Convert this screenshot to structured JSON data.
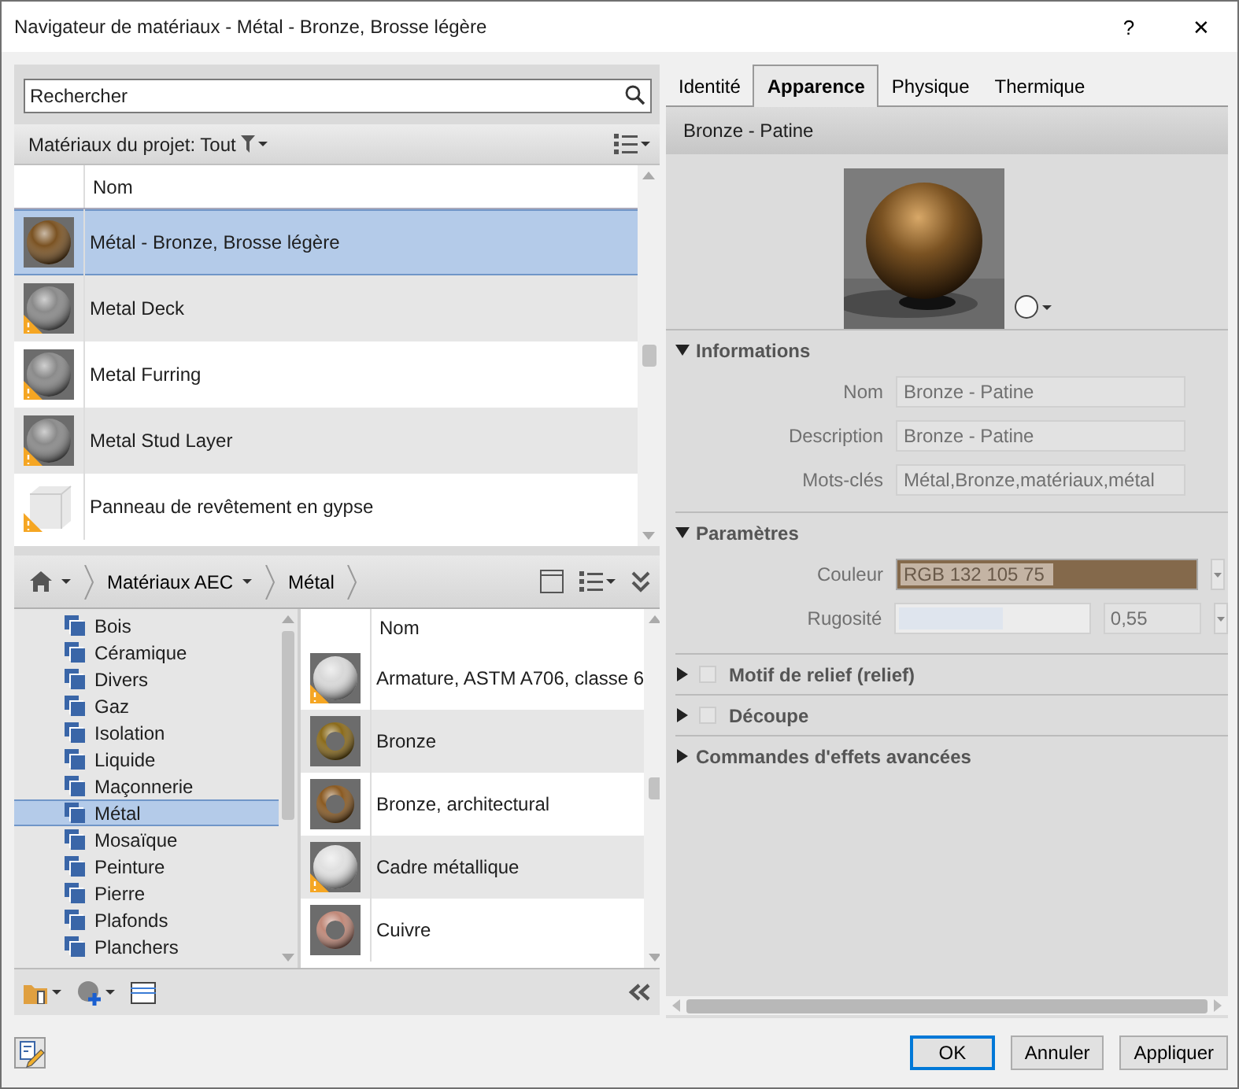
{
  "window": {
    "title": "Navigateur de matériaux - Métal - Bronze, Brosse légère",
    "help": "?",
    "close": "✕"
  },
  "search": {
    "placeholder": "Rechercher"
  },
  "project_filter": {
    "label": "Matériaux du projet: Tout"
  },
  "project_table": {
    "columns": [
      "Nom"
    ],
    "rows": [
      {
        "name": "Métal - Bronze, Brosse légère",
        "kind": "sphere",
        "color": "#7a5222",
        "warning": false,
        "selected": true
      },
      {
        "name": "Metal Deck",
        "kind": "sphere",
        "color": "#8a8a8a",
        "warning": true,
        "selected": false
      },
      {
        "name": "Metal Furring",
        "kind": "sphere",
        "color": "#8a8a8a",
        "warning": true,
        "selected": false
      },
      {
        "name": "Metal Stud Layer",
        "kind": "sphere",
        "color": "#8a8a8a",
        "warning": true,
        "selected": false
      },
      {
        "name": "Panneau de revêtement en gypse",
        "kind": "cube",
        "color": "#e8e8e8",
        "warning": true,
        "selected": false
      }
    ]
  },
  "breadcrumb": [
    {
      "label": "Matériaux AEC",
      "dropdown": true
    },
    {
      "label": "Métal",
      "dropdown": false
    }
  ],
  "library_tree": {
    "items": [
      {
        "label": "Bois",
        "selected": false
      },
      {
        "label": "Céramique",
        "selected": false
      },
      {
        "label": "Divers",
        "selected": false
      },
      {
        "label": "Gaz",
        "selected": false
      },
      {
        "label": "Isolation",
        "selected": false
      },
      {
        "label": "Liquide",
        "selected": false
      },
      {
        "label": "Maçonnerie",
        "selected": false
      },
      {
        "label": "Métal",
        "selected": true
      },
      {
        "label": "Mosaïque",
        "selected": false
      },
      {
        "label": "Peinture",
        "selected": false
      },
      {
        "label": "Pierre",
        "selected": false
      },
      {
        "label": "Plafonds",
        "selected": false
      },
      {
        "label": "Planchers",
        "selected": false
      }
    ]
  },
  "library_table": {
    "columns": [
      "Nom"
    ],
    "rows": [
      {
        "name": "Armature, ASTM A706, classe 6",
        "kind": "sphere",
        "color": "#d8d8d8",
        "warning": true,
        "selected": false
      },
      {
        "name": "Bronze",
        "kind": "torus",
        "color": "#8a6a1a",
        "warning": false,
        "selected": false
      },
      {
        "name": "Bronze, architectural",
        "kind": "torus",
        "color": "#8a5a22",
        "warning": false,
        "selected": false
      },
      {
        "name": "Cadre métallique",
        "kind": "sphere",
        "color": "#e0e0e0",
        "warning": true,
        "selected": false
      },
      {
        "name": "Cuivre",
        "kind": "torus",
        "color": "#c08878",
        "warning": false,
        "selected": false
      }
    ]
  },
  "tabs": [
    {
      "label": "Identité",
      "selected": false
    },
    {
      "label": "Apparence",
      "selected": true
    },
    {
      "label": "Physique",
      "selected": false
    },
    {
      "label": "Thermique",
      "selected": false
    }
  ],
  "asset": {
    "name": "Bronze - Patine"
  },
  "sections": [
    {
      "kind": "fields",
      "title": "Informations",
      "expanded": true,
      "fields": [
        {
          "label": "Nom",
          "value": "Bronze - Patine"
        },
        {
          "label": "Description",
          "value": "Bronze - Patine"
        },
        {
          "label": "Mots-clés",
          "value": "Métal,Bronze,matériaux,métal"
        }
      ]
    },
    {
      "kind": "params",
      "title": "Paramètres",
      "expanded": true,
      "params": [
        {
          "kind": "color",
          "label": "Couleur",
          "value": "RGB 132 105 75",
          "color": "#84694b"
        },
        {
          "kind": "slider",
          "label": "Rugosité",
          "level": 0.55,
          "value": "0,55"
        }
      ]
    },
    {
      "kind": "toggle",
      "title": "Motif de relief (relief)",
      "expanded": false,
      "checked": false
    },
    {
      "kind": "toggle",
      "title": "Découpe",
      "expanded": false,
      "checked": false
    },
    {
      "kind": "plain",
      "title": "Commandes d'effets avancées",
      "expanded": false
    }
  ],
  "buttons": [
    {
      "label": "OK",
      "default": true
    },
    {
      "label": "Annuler",
      "default": false
    },
    {
      "label": "Appliquer",
      "default": false
    }
  ]
}
